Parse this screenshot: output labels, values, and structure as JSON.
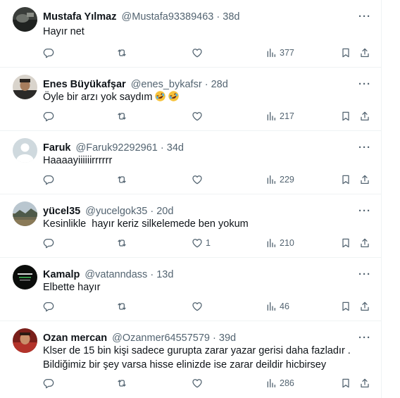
{
  "tweets": [
    {
      "display_name": "Mustafa Yılmaz",
      "handle": "@Mustafa93389463",
      "separator": "·",
      "age": "38d",
      "text": "Hayır net",
      "likes": "",
      "views": "377",
      "avatar": "dark-landscape-photo"
    },
    {
      "display_name": "Enes Büyükafşar",
      "handle": "@enes_bykafsr",
      "separator": "·",
      "age": "28d",
      "text": "Öyle bir arzı yok saydım",
      "emoji": [
        "rofl",
        "rofl"
      ],
      "likes": "",
      "views": "217",
      "avatar": "person-photo"
    },
    {
      "display_name": "Faruk",
      "handle": "@Faruk92292961",
      "separator": "·",
      "age": "34d",
      "text": "Haaaayiiiiiirrrrrr",
      "likes": "",
      "views": "229",
      "avatar": "default-profile"
    },
    {
      "display_name": "yücel35",
      "handle": "@yucelgok35",
      "separator": "·",
      "age": "20d",
      "text": "Kesinlikle  hayır keriz silkelemede ben yokum",
      "likes": "1",
      "views": "210",
      "avatar": "landscape-photo"
    },
    {
      "display_name": "Kamalp",
      "handle": "@vatanndass",
      "separator": "·",
      "age": "13d",
      "text": "Elbette hayır",
      "likes": "",
      "views": "46",
      "avatar": "dark-logo"
    },
    {
      "display_name": "Ozan mercan",
      "handle": "@Ozanmer64557579",
      "separator": "·",
      "age": "39d",
      "text": "Klser de 15 bin kişi sadece gurupta zarar yazar gerisi daha fazladır .\nBildiğimiz bir şey varsa hisse elinizde ise zarar deildir hicbirsey",
      "likes": "",
      "views": "286",
      "avatar": "red-photo"
    }
  ],
  "more_label": "···",
  "colors": {
    "text_primary": "#0f1419",
    "text_secondary": "#536471",
    "divider": "#eff3f4"
  },
  "icons": [
    "reply-icon",
    "retweet-icon",
    "like-icon",
    "views-icon",
    "bookmark-icon",
    "share-icon",
    "more-icon"
  ]
}
